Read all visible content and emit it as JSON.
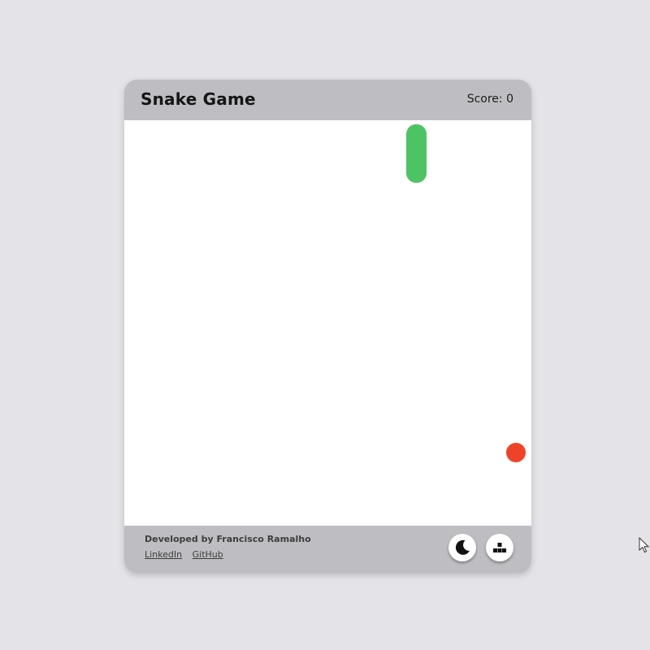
{
  "header": {
    "title": "Snake Game",
    "score": "Score: 0"
  },
  "game": {
    "snake_color": "#4dc463",
    "food_color": "#ef4328",
    "snake_direction": "vertical",
    "snake_length": 3
  },
  "footer": {
    "developer": "Developed by Francisco Ramalho",
    "linkedin_label": "LinkedIn",
    "github_label": "GitHub"
  },
  "controls": {
    "theme_icon": "moon-icon",
    "board_icon": "blocks-icon"
  }
}
